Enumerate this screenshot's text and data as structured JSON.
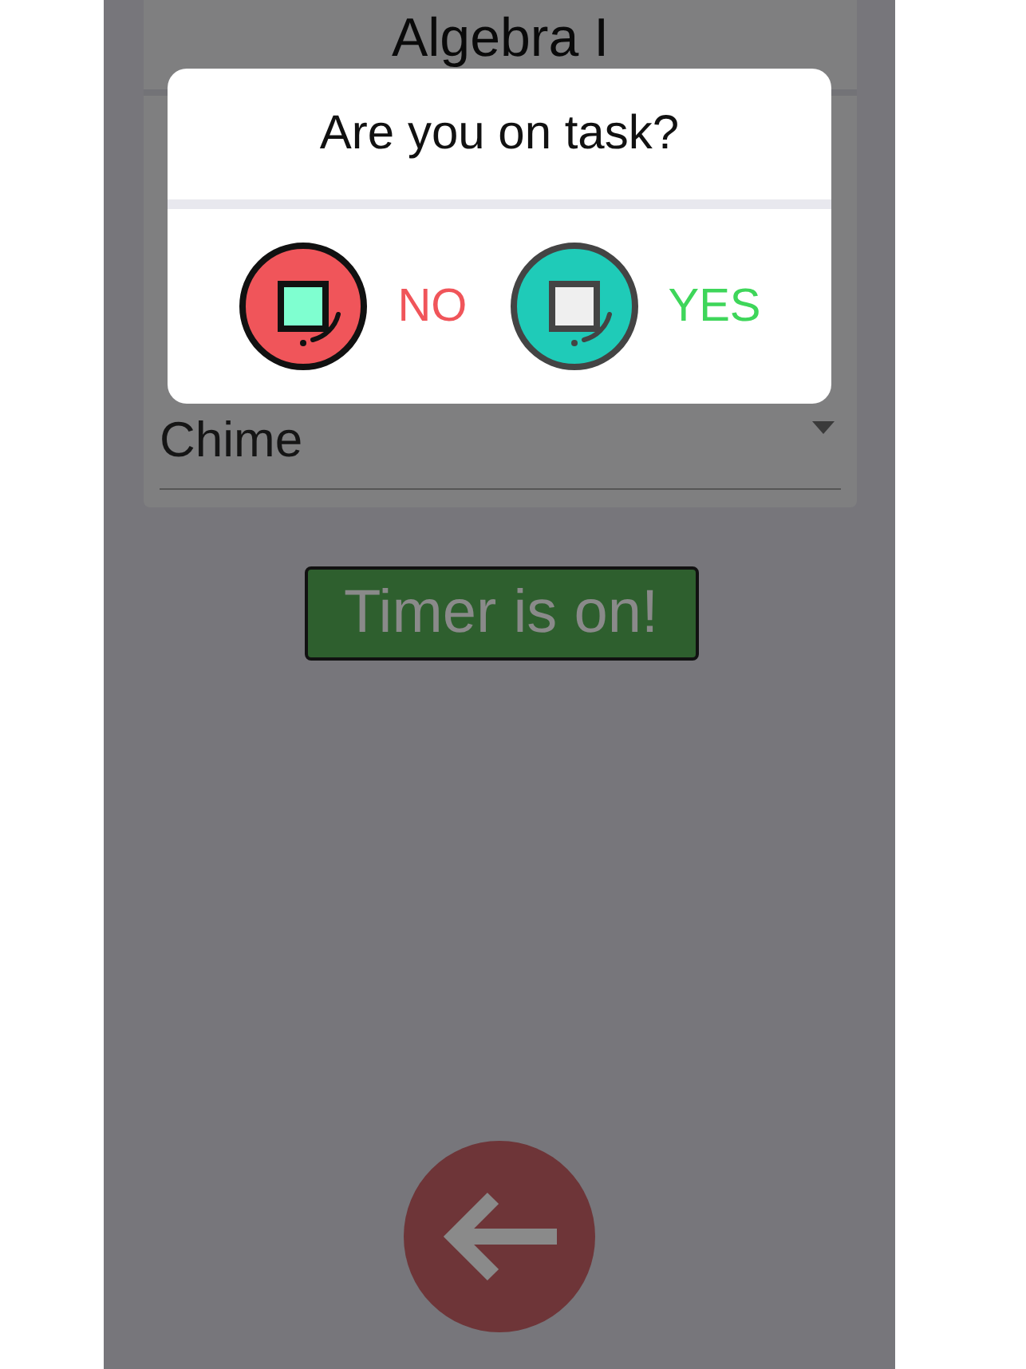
{
  "card": {
    "title": "Algebra I",
    "sound_select": {
      "value": "Chime"
    }
  },
  "timer_status": "Timer is on!",
  "dialog": {
    "title": "Are you on task?",
    "options": [
      {
        "kind": "no",
        "label": "NO"
      },
      {
        "kind": "yes",
        "label": "YES"
      }
    ]
  }
}
